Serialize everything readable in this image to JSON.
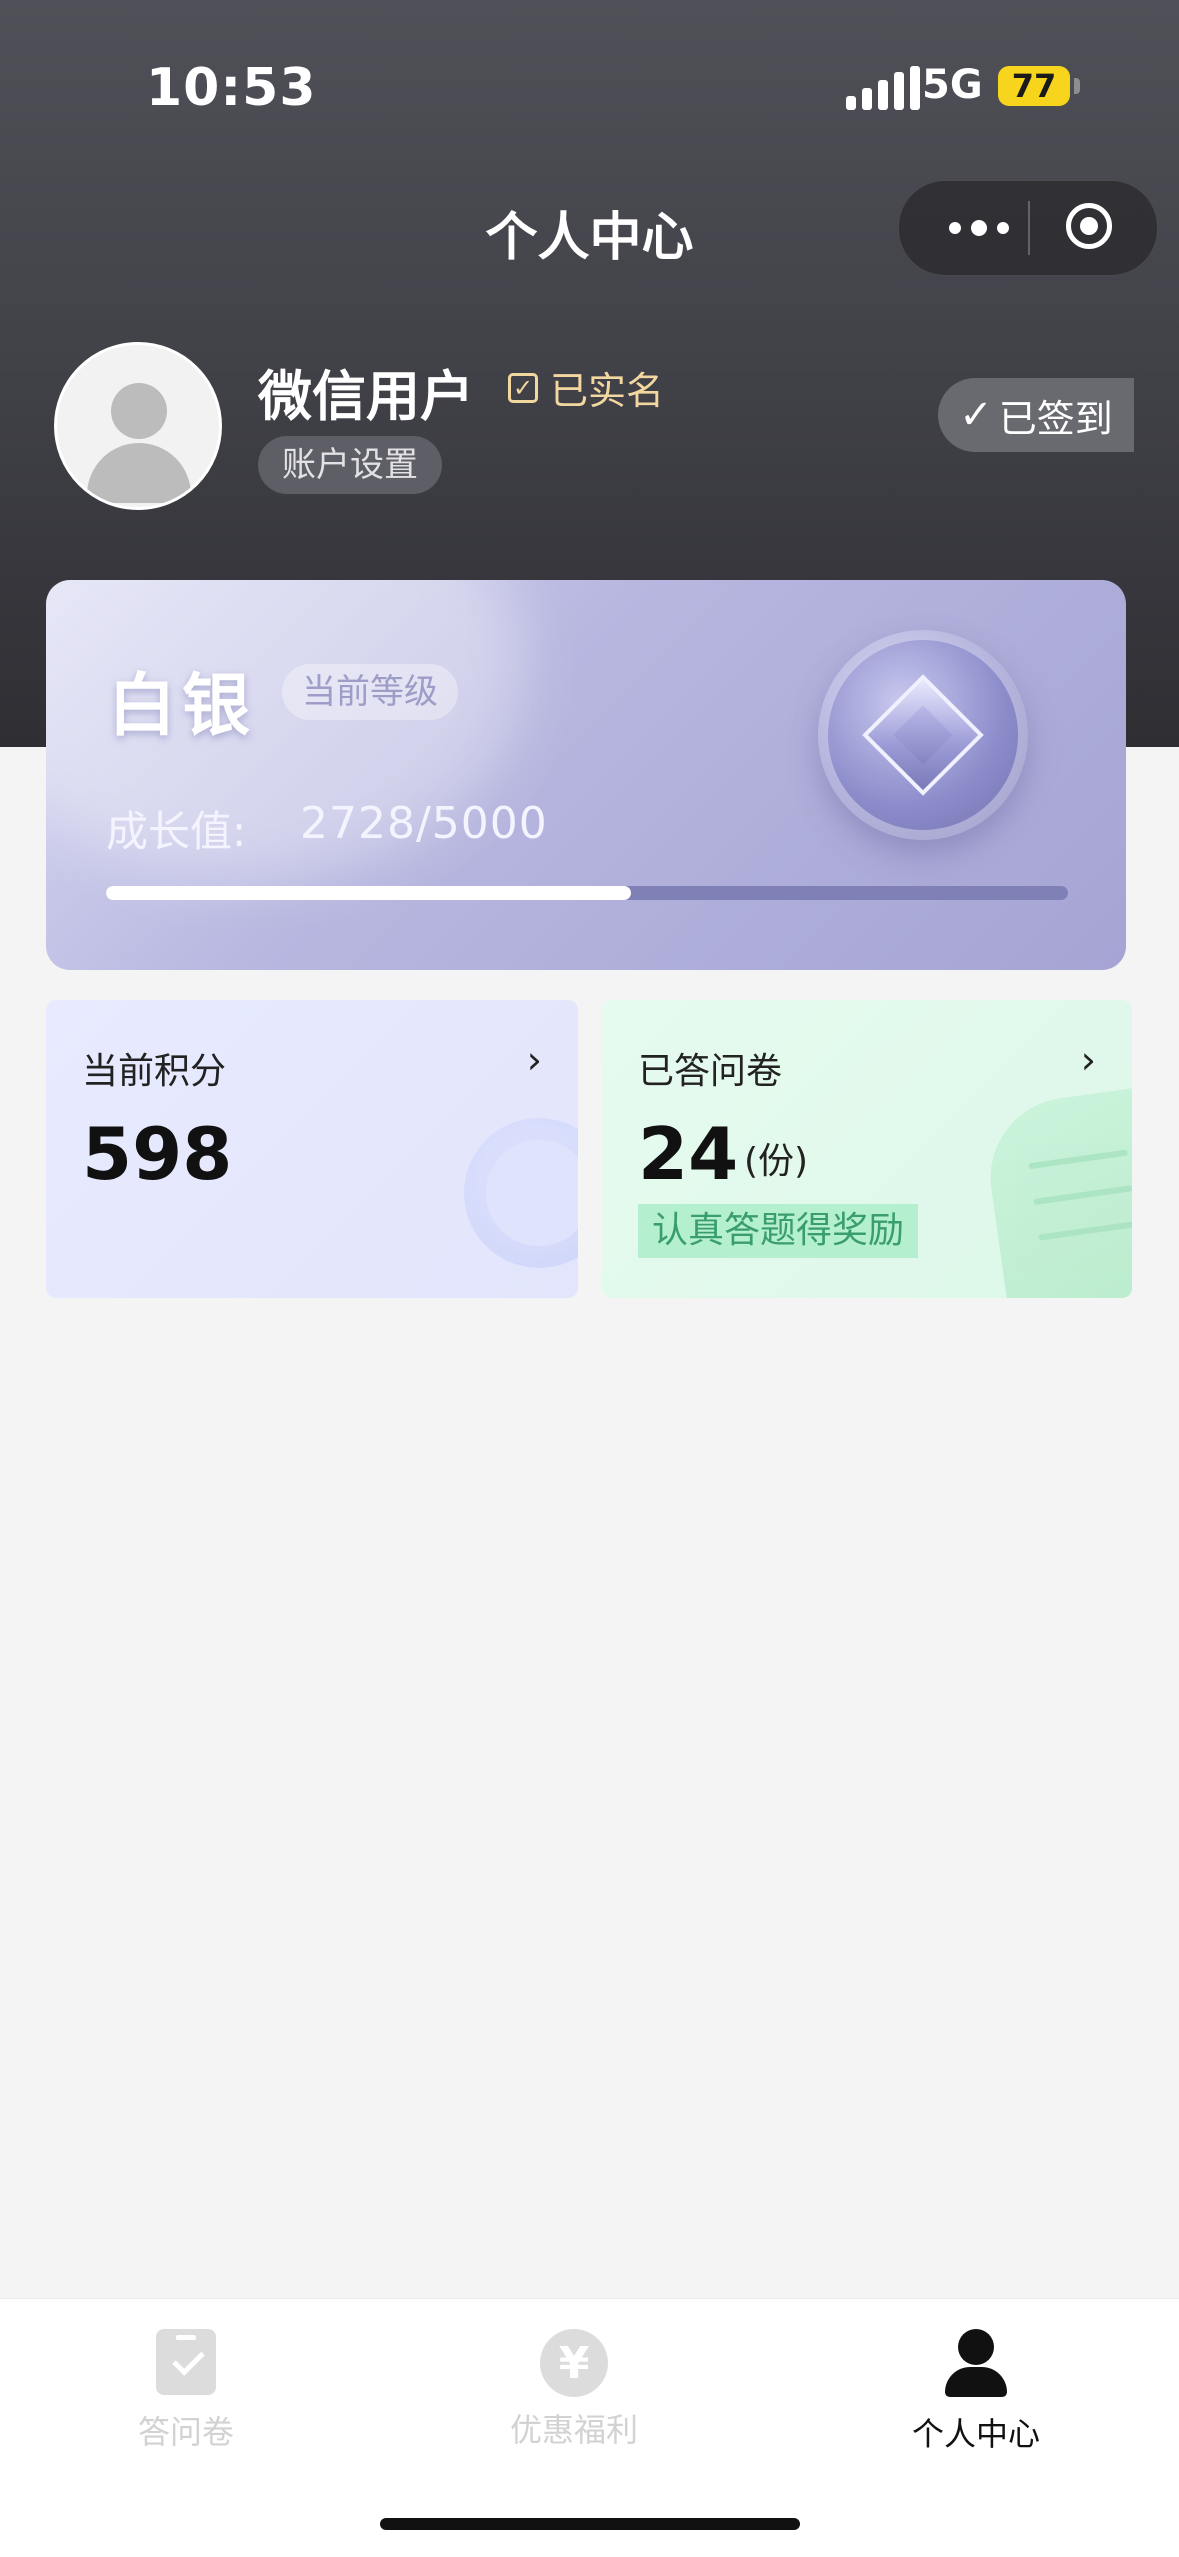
{
  "status_bar": {
    "time": "10:53",
    "network": "5G",
    "battery": "77"
  },
  "nav": {
    "title": "个人中心",
    "more_icon": "more-dots-icon",
    "close_icon": "target-circle-icon"
  },
  "profile": {
    "name": "微信用户",
    "verified_label": "已实名",
    "account_settings": "账户设置",
    "signin_label": "已签到"
  },
  "level": {
    "name": "白银",
    "tag": "当前等级",
    "growth_label": "成长值:",
    "growth_value": "2728/5000",
    "growth_current": 2728,
    "growth_max": 5000
  },
  "stats": {
    "points": {
      "label": "当前积分",
      "value": "598"
    },
    "surveys": {
      "label": "已答问卷",
      "value": "24",
      "unit": "(份)",
      "tip": "认真答题得奖励"
    }
  },
  "tabbar": {
    "items": [
      {
        "label": "答问卷",
        "icon": "clipboard-check-icon",
        "active": false
      },
      {
        "label": "优惠福利",
        "icon": "yen-coin-icon",
        "active": false
      },
      {
        "label": "个人中心",
        "icon": "person-icon",
        "active": true
      }
    ]
  },
  "colors": {
    "header_bg": "#3f3f46",
    "verified_gold": "#f3d7a0",
    "level_card": "#b7b7e0",
    "tip_green": "#3a9e6c"
  }
}
